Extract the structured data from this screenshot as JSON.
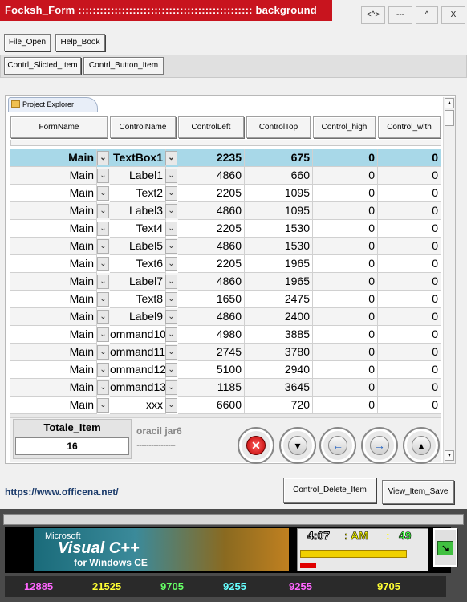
{
  "window": {
    "title": "Focksh_Form :::::::::::::::::::::::::::::::::::::::::::::::: background",
    "controls": [
      "<^>",
      "---",
      "^",
      "X"
    ]
  },
  "toolbar": {
    "file_open": "File_Open",
    "help_book": "Help_Book"
  },
  "tabs": {
    "sliced": "Contrl_Slicted_Item",
    "button": "Contrl_Button_Item"
  },
  "explorer": {
    "tab_label": "Project Explorer"
  },
  "columns": [
    "FormName",
    "ControlName",
    "ControlLeft",
    "ControlTop",
    "Control_high",
    "Control_with"
  ],
  "rows": [
    {
      "form": "Main",
      "control": "TextBox1",
      "left": "2235",
      "top": "675",
      "high": "0",
      "with": "0",
      "selected": true
    },
    {
      "form": "Main",
      "control": "Label1",
      "left": "4860",
      "top": "660",
      "high": "0",
      "with": "0"
    },
    {
      "form": "Main",
      "control": "Text2",
      "left": "2205",
      "top": "1095",
      "high": "0",
      "with": "0"
    },
    {
      "form": "Main",
      "control": "Label3",
      "left": "4860",
      "top": "1095",
      "high": "0",
      "with": "0"
    },
    {
      "form": "Main",
      "control": "Text4",
      "left": "2205",
      "top": "1530",
      "high": "0",
      "with": "0"
    },
    {
      "form": "Main",
      "control": "Label5",
      "left": "4860",
      "top": "1530",
      "high": "0",
      "with": "0"
    },
    {
      "form": "Main",
      "control": "Text6",
      "left": "2205",
      "top": "1965",
      "high": "0",
      "with": "0"
    },
    {
      "form": "Main",
      "control": "Label7",
      "left": "4860",
      "top": "1965",
      "high": "0",
      "with": "0"
    },
    {
      "form": "Main",
      "control": "Text8",
      "left": "1650",
      "top": "2475",
      "high": "0",
      "with": "0"
    },
    {
      "form": "Main",
      "control": "Label9",
      "left": "4860",
      "top": "2400",
      "high": "0",
      "with": "0"
    },
    {
      "form": "Main",
      "control": "ommand10",
      "left": "4980",
      "top": "3885",
      "high": "0",
      "with": "0"
    },
    {
      "form": "Main",
      "control": "ommand11",
      "left": "2745",
      "top": "3780",
      "high": "0",
      "with": "0"
    },
    {
      "form": "Main",
      "control": "ommand12",
      "left": "5100",
      "top": "2940",
      "high": "0",
      "with": "0"
    },
    {
      "form": "Main",
      "control": "ommand13",
      "left": "1185",
      "top": "3645",
      "high": "0",
      "with": "0"
    },
    {
      "form": "Main",
      "control": "xxx",
      "left": "6600",
      "top": "720",
      "high": "0",
      "with": "0"
    }
  ],
  "totals": {
    "label": "Totale_Item",
    "value": "16"
  },
  "status": {
    "oracle_label": "oracil jar6",
    "dots": "::::::::::::::::::::::::::::::::"
  },
  "nav_icons": [
    "stop-icon",
    "down-icon",
    "left-icon",
    "right-icon",
    "up-icon"
  ],
  "footer": {
    "link": "https://www.officena.net/",
    "delete_button": "Control_Delete_Item",
    "save_button": "View_Item_Save"
  },
  "banner": {
    "line1": "Microsoft",
    "line2": "Visual C++",
    "line3": "for Windows CE"
  },
  "clock": {
    "hour": "4:07",
    "ampm": ": AM",
    "sep": ":",
    "seconds": "49",
    "progress": 0.95
  },
  "numbers": [
    {
      "value": "12885",
      "color": "#ff66ff"
    },
    {
      "value": "21525",
      "color": "#ffff33"
    },
    {
      "value": "9705",
      "color": "#66ff66"
    },
    {
      "value": "9255",
      "color": "#66ffff"
    },
    {
      "value": "9255",
      "color": "#ff66ff"
    },
    {
      "value": "9705",
      "color": "#ffff33"
    }
  ]
}
